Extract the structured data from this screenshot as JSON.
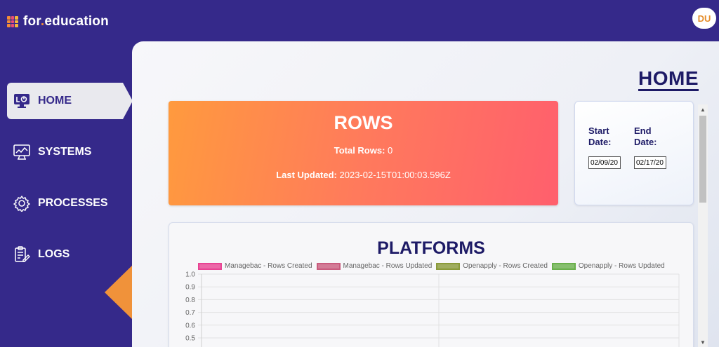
{
  "app": {
    "logo_text_before_dot": "for",
    "logo_dot": ".",
    "logo_text_after_dot": "education",
    "logo_colors": [
      "#f28c38",
      "#e94e77",
      "#f6b93b",
      "#f28c38",
      "#e94e77",
      "#f6b93b",
      "#f28c38",
      "#e94e77",
      "#f6b93b"
    ],
    "avatar_initials": "DU"
  },
  "sidebar": {
    "items": [
      {
        "label": "HOME",
        "icon": "monitor-dashboard-icon",
        "active": true
      },
      {
        "label": "SYSTEMS",
        "icon": "monitor-chart-icon",
        "active": false
      },
      {
        "label": "PROCESSES",
        "icon": "gear-icon",
        "active": false
      },
      {
        "label": "LOGS",
        "icon": "clipboard-edit-icon",
        "active": false
      }
    ]
  },
  "main": {
    "page_title": "HOME",
    "rows_card": {
      "title": "ROWS",
      "total_rows_label": "Total Rows:",
      "total_rows_value": "0",
      "last_updated_label": "Last Updated:",
      "last_updated_value": "2023-02-15T01:00:03.596Z"
    },
    "date_filter": {
      "start_label": "Start Date:",
      "start_value": "02/09/20",
      "end_label": "End Date:",
      "end_value": "02/17/20"
    },
    "platforms": {
      "title": "PLATFORMS"
    }
  },
  "colors": {
    "sidebar_bg": "#35298a",
    "accent_orange": "#f0923a",
    "title_navy": "#1d1a66"
  },
  "chart_data": {
    "type": "bar",
    "title": "PLATFORMS",
    "series": [
      {
        "name": "Managebac - Rows Created",
        "color": "#e84393",
        "values": []
      },
      {
        "name": "Managebac - Rows Updated",
        "color": "#c95c7e",
        "values": []
      },
      {
        "name": "Openapply - Rows Created",
        "color": "#8a9a3a",
        "values": []
      },
      {
        "name": "Openapply - Rows Updated",
        "color": "#6ab04c",
        "values": []
      }
    ],
    "yticks": [
      "1.0",
      "0.9",
      "0.8",
      "0.7",
      "0.6",
      "0.5"
    ],
    "ylim": [
      0,
      1.0
    ],
    "grid": true,
    "legend": "top"
  }
}
